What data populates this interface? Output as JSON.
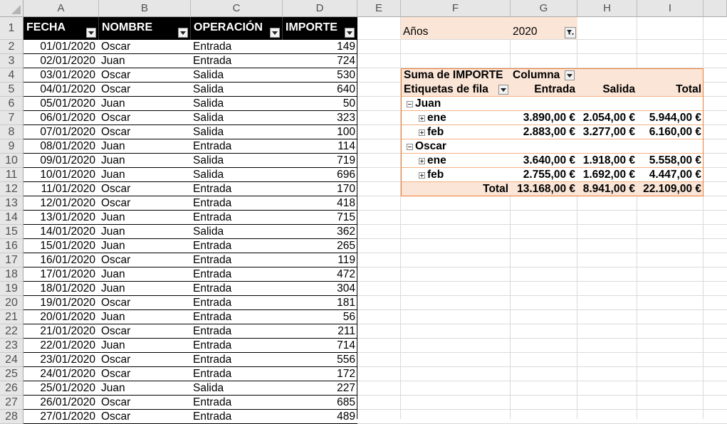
{
  "columns": [
    "A",
    "B",
    "C",
    "D",
    "E",
    "F",
    "G",
    "H",
    "I"
  ],
  "rows": [
    1,
    2,
    3,
    4,
    5,
    6,
    7,
    8,
    9,
    10,
    11,
    12,
    13,
    14,
    15,
    16,
    17,
    18,
    19,
    20,
    21,
    22,
    23,
    24,
    25,
    26,
    27,
    28
  ],
  "table": {
    "headers": [
      "FECHA",
      "NOMBRE",
      "OPERACIÓN",
      "IMPORTE"
    ],
    "data": [
      [
        "01/01/2020",
        "Oscar",
        "Entrada",
        "149"
      ],
      [
        "02/01/2020",
        "Juan",
        "Entrada",
        "724"
      ],
      [
        "03/01/2020",
        "Oscar",
        "Salida",
        "530"
      ],
      [
        "04/01/2020",
        "Oscar",
        "Salida",
        "640"
      ],
      [
        "05/01/2020",
        "Juan",
        "Salida",
        "50"
      ],
      [
        "06/01/2020",
        "Oscar",
        "Salida",
        "323"
      ],
      [
        "07/01/2020",
        "Oscar",
        "Salida",
        "100"
      ],
      [
        "08/01/2020",
        "Juan",
        "Entrada",
        "114"
      ],
      [
        "09/01/2020",
        "Juan",
        "Salida",
        "719"
      ],
      [
        "10/01/2020",
        "Juan",
        "Salida",
        "696"
      ],
      [
        "11/01/2020",
        "Oscar",
        "Entrada",
        "170"
      ],
      [
        "12/01/2020",
        "Oscar",
        "Entrada",
        "418"
      ],
      [
        "13/01/2020",
        "Juan",
        "Entrada",
        "715"
      ],
      [
        "14/01/2020",
        "Juan",
        "Salida",
        "362"
      ],
      [
        "15/01/2020",
        "Juan",
        "Entrada",
        "265"
      ],
      [
        "16/01/2020",
        "Oscar",
        "Entrada",
        "119"
      ],
      [
        "17/01/2020",
        "Juan",
        "Entrada",
        "472"
      ],
      [
        "18/01/2020",
        "Juan",
        "Entrada",
        "304"
      ],
      [
        "19/01/2020",
        "Oscar",
        "Entrada",
        "181"
      ],
      [
        "20/01/2020",
        "Juan",
        "Entrada",
        "56"
      ],
      [
        "21/01/2020",
        "Oscar",
        "Entrada",
        "211"
      ],
      [
        "22/01/2020",
        "Juan",
        "Entrada",
        "714"
      ],
      [
        "23/01/2020",
        "Oscar",
        "Entrada",
        "556"
      ],
      [
        "24/01/2020",
        "Oscar",
        "Entrada",
        "172"
      ],
      [
        "25/01/2020",
        "Juan",
        "Salida",
        "227"
      ],
      [
        "26/01/2020",
        "Oscar",
        "Entrada",
        "685"
      ],
      [
        "27/01/2020",
        "Oscar",
        "Entrada",
        "489"
      ]
    ]
  },
  "pivot": {
    "filter_label": "Años",
    "filter_value": "2020",
    "values_label": "Suma de IMPORTE",
    "columns_label": "Columna",
    "rows_label": "Etiquetas de fila",
    "col_headers": [
      "Entrada",
      "Salida",
      "Total"
    ],
    "groups": [
      {
        "name": "Juan",
        "months": [
          {
            "label": "ene",
            "values": [
              "3.890,00 €",
              "2.054,00 €",
              "5.944,00 €"
            ]
          },
          {
            "label": "feb",
            "values": [
              "2.883,00 €",
              "3.277,00 €",
              "6.160,00 €"
            ]
          }
        ]
      },
      {
        "name": "Oscar",
        "months": [
          {
            "label": "ene",
            "values": [
              "3.640,00 €",
              "1.918,00 €",
              "5.558,00 €"
            ]
          },
          {
            "label": "feb",
            "values": [
              "2.755,00 €",
              "1.692,00 €",
              "4.447,00 €"
            ]
          }
        ]
      }
    ],
    "total_label": "Total",
    "total_values": [
      "13.168,00 €",
      "8.941,00 €",
      "22.109,00 €"
    ]
  },
  "colors": {
    "header_bg": "#e6e6e6",
    "table_header_bg": "#000000",
    "pivot_fill": "#fbe5d6",
    "pivot_border": "#f4b183"
  }
}
